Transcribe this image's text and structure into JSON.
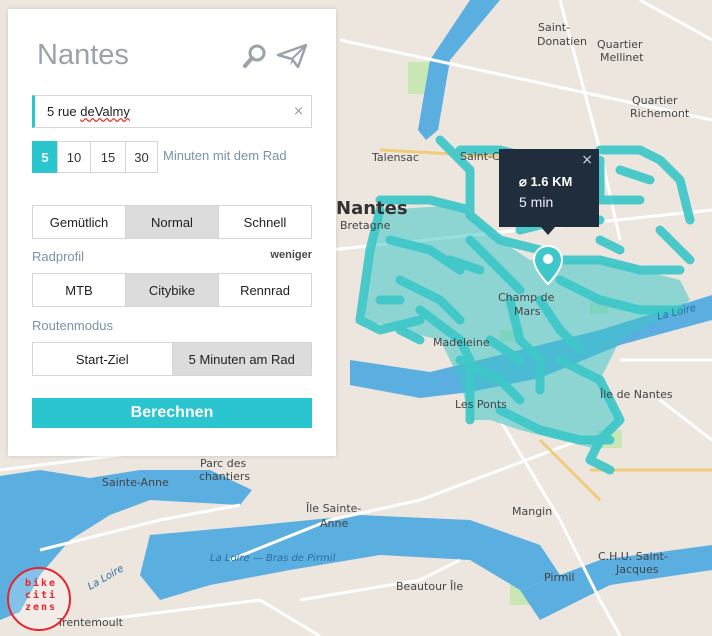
{
  "panel": {
    "city": "Nantes",
    "icons": {
      "search": "search-icon",
      "locate": "paper-plane-icon"
    },
    "address": {
      "value": "5 rue deValmy",
      "part1": "5 rue ",
      "part2": "deValmy",
      "clear": "×"
    },
    "minutes": {
      "options": [
        "5",
        "10",
        "15",
        "30"
      ],
      "selected": "5",
      "suffix": "Minuten mit dem Rad"
    },
    "speed": {
      "options": [
        "Gemütlich",
        "Normal",
        "Schnell"
      ],
      "selected": "Normal"
    },
    "radprofil": {
      "label": "Radprofil",
      "toggle": "weniger",
      "options": [
        "MTB",
        "Citybike",
        "Rennrad"
      ],
      "selected": "Citybike"
    },
    "routenmodus": {
      "label": "Routenmodus",
      "options": [
        "Start-Ziel",
        "5 Minuten am Rad"
      ],
      "selected": "5 Minuten am Rad"
    },
    "calculate": "Berechnen"
  },
  "popup": {
    "distance": "⌀ 1.6 KM",
    "time": "5 min",
    "close": "×"
  },
  "logo": {
    "lines": [
      "bike",
      "citi",
      "zens"
    ]
  },
  "map": {
    "labels": {
      "saint_donatien": "Saint-\nDonatien",
      "quartier_mellinet": "Quartier\nMellinet",
      "quartier_richemont": "Quartier\nRichemont",
      "talensac": "Talensac",
      "saint_clement": "Saint-Cl",
      "nantes": "Nantes",
      "bretagne": "Bretagne",
      "champ_de_mars": "Champ de\nMars",
      "madeleine": "Madeleine",
      "la_loire": "La Loire",
      "ile_de_nantes": "Île de Nantes",
      "les_ponts": "Les Ponts",
      "parc_des_chantiers": "Parc des\nchantiers",
      "sainte_anne": "Sainte-Anne",
      "ile_sainte_anne": "Île Sainte-\nAnne",
      "mangin": "Mangin",
      "bras_de_pirmil": "La Loire — Bras de Pirmil",
      "la_loire_w": "La Loire",
      "chu": "C.H.U. Saint-\nJacques",
      "pirmil": "Pirmil",
      "beaulieu": "Beautour Île",
      "trentemoult": "Trentemoult"
    }
  },
  "colors": {
    "accent": "#2bc5cf",
    "isochrone": "#3ec7c9",
    "water": "#5aaee0",
    "popup_bg": "#1f2d3d",
    "logo": "#e8232a"
  }
}
